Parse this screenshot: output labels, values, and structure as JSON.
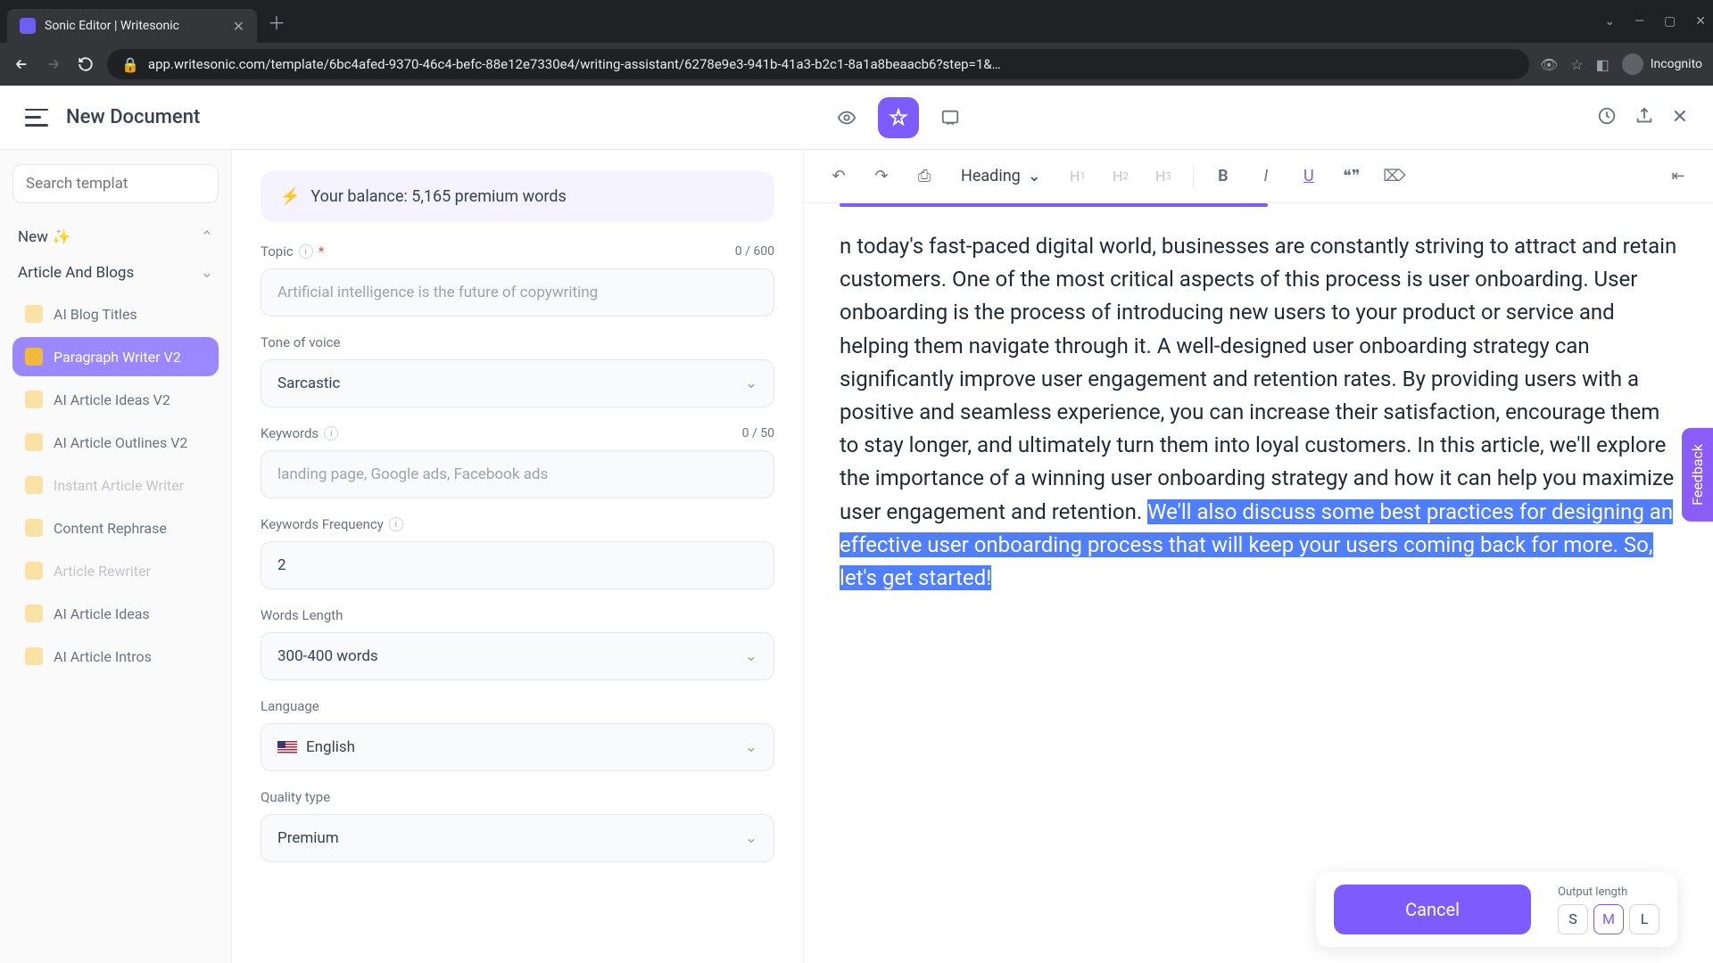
{
  "browser": {
    "tab_title": "Sonic Editor | Writesonic",
    "url": "app.writesonic.com/template/6bc4afed-9370-46c4-befc-88e12e7330e4/writing-assistant/6278e9e3-941b-41a3-b2c1-8a1a8beaacb6?step=1&…",
    "incognito": "Incognito"
  },
  "header": {
    "doc_title": "New Document"
  },
  "sidebar": {
    "search_placeholder": "Search templat",
    "sections": {
      "new": "New ✨",
      "articles": "Article And Blogs"
    },
    "items": [
      {
        "label": "AI Blog Titles",
        "active": false
      },
      {
        "label": "Paragraph Writer V2",
        "active": true
      },
      {
        "label": "AI Article Ideas V2",
        "active": false
      },
      {
        "label": "AI Article Outlines V2",
        "active": false
      },
      {
        "label": "Instant Article Writer",
        "active": false,
        "disabled": true
      },
      {
        "label": "Content Rephrase",
        "active": false
      },
      {
        "label": "Article Rewriter",
        "active": false,
        "disabled": true
      },
      {
        "label": "AI Article Ideas",
        "active": false
      },
      {
        "label": "AI Article Intros",
        "active": false
      }
    ]
  },
  "form": {
    "balance": "Your balance: 5,165 premium words",
    "topic": {
      "label": "Topic",
      "counter": "0 / 600",
      "placeholder": "Artificial intelligence is the future of copywriting"
    },
    "tone": {
      "label": "Tone of voice",
      "value": "Sarcastic"
    },
    "keywords": {
      "label": "Keywords",
      "counter": "0 / 50",
      "placeholder": "landing page, Google ads, Facebook ads"
    },
    "kw_freq": {
      "label": "Keywords Frequency",
      "value": "2"
    },
    "words_length": {
      "label": "Words Length",
      "value": "300-400 words"
    },
    "language": {
      "label": "Language",
      "value": "English"
    },
    "quality": {
      "label": "Quality type",
      "value": "Premium"
    }
  },
  "toolbar": {
    "heading": "Heading",
    "h1": "H",
    "h1s": "1",
    "h2": "H",
    "h2s": "2",
    "h3": "H",
    "h3s": "3"
  },
  "editor": {
    "text_pre": "n today's fast-paced digital world, businesses are constantly striving to attract and retain customers. One of the most critical aspects of this process is user onboarding. User onboarding is the process of introducing new users to your product or service and helping them navigate through it. A well-designed user onboarding strategy can significantly improve user engagement and retention rates. By providing users with a positive and seamless experience, you can increase their satisfaction, encourage them to stay longer, and ultimately turn them into loyal customers. In this article, we'll explore the importance of a winning user onboarding strategy and how it can help you maximize user engagement and retention. ",
    "text_sel": "We'll also discuss some best practices for designing an effective user onboarding process that will keep your users coming back for more. So, let's get started!"
  },
  "bottom": {
    "cancel": "Cancel",
    "output_length_label": "Output length",
    "s": "S",
    "m": "M",
    "l": "L"
  },
  "feedback": "Feedback"
}
